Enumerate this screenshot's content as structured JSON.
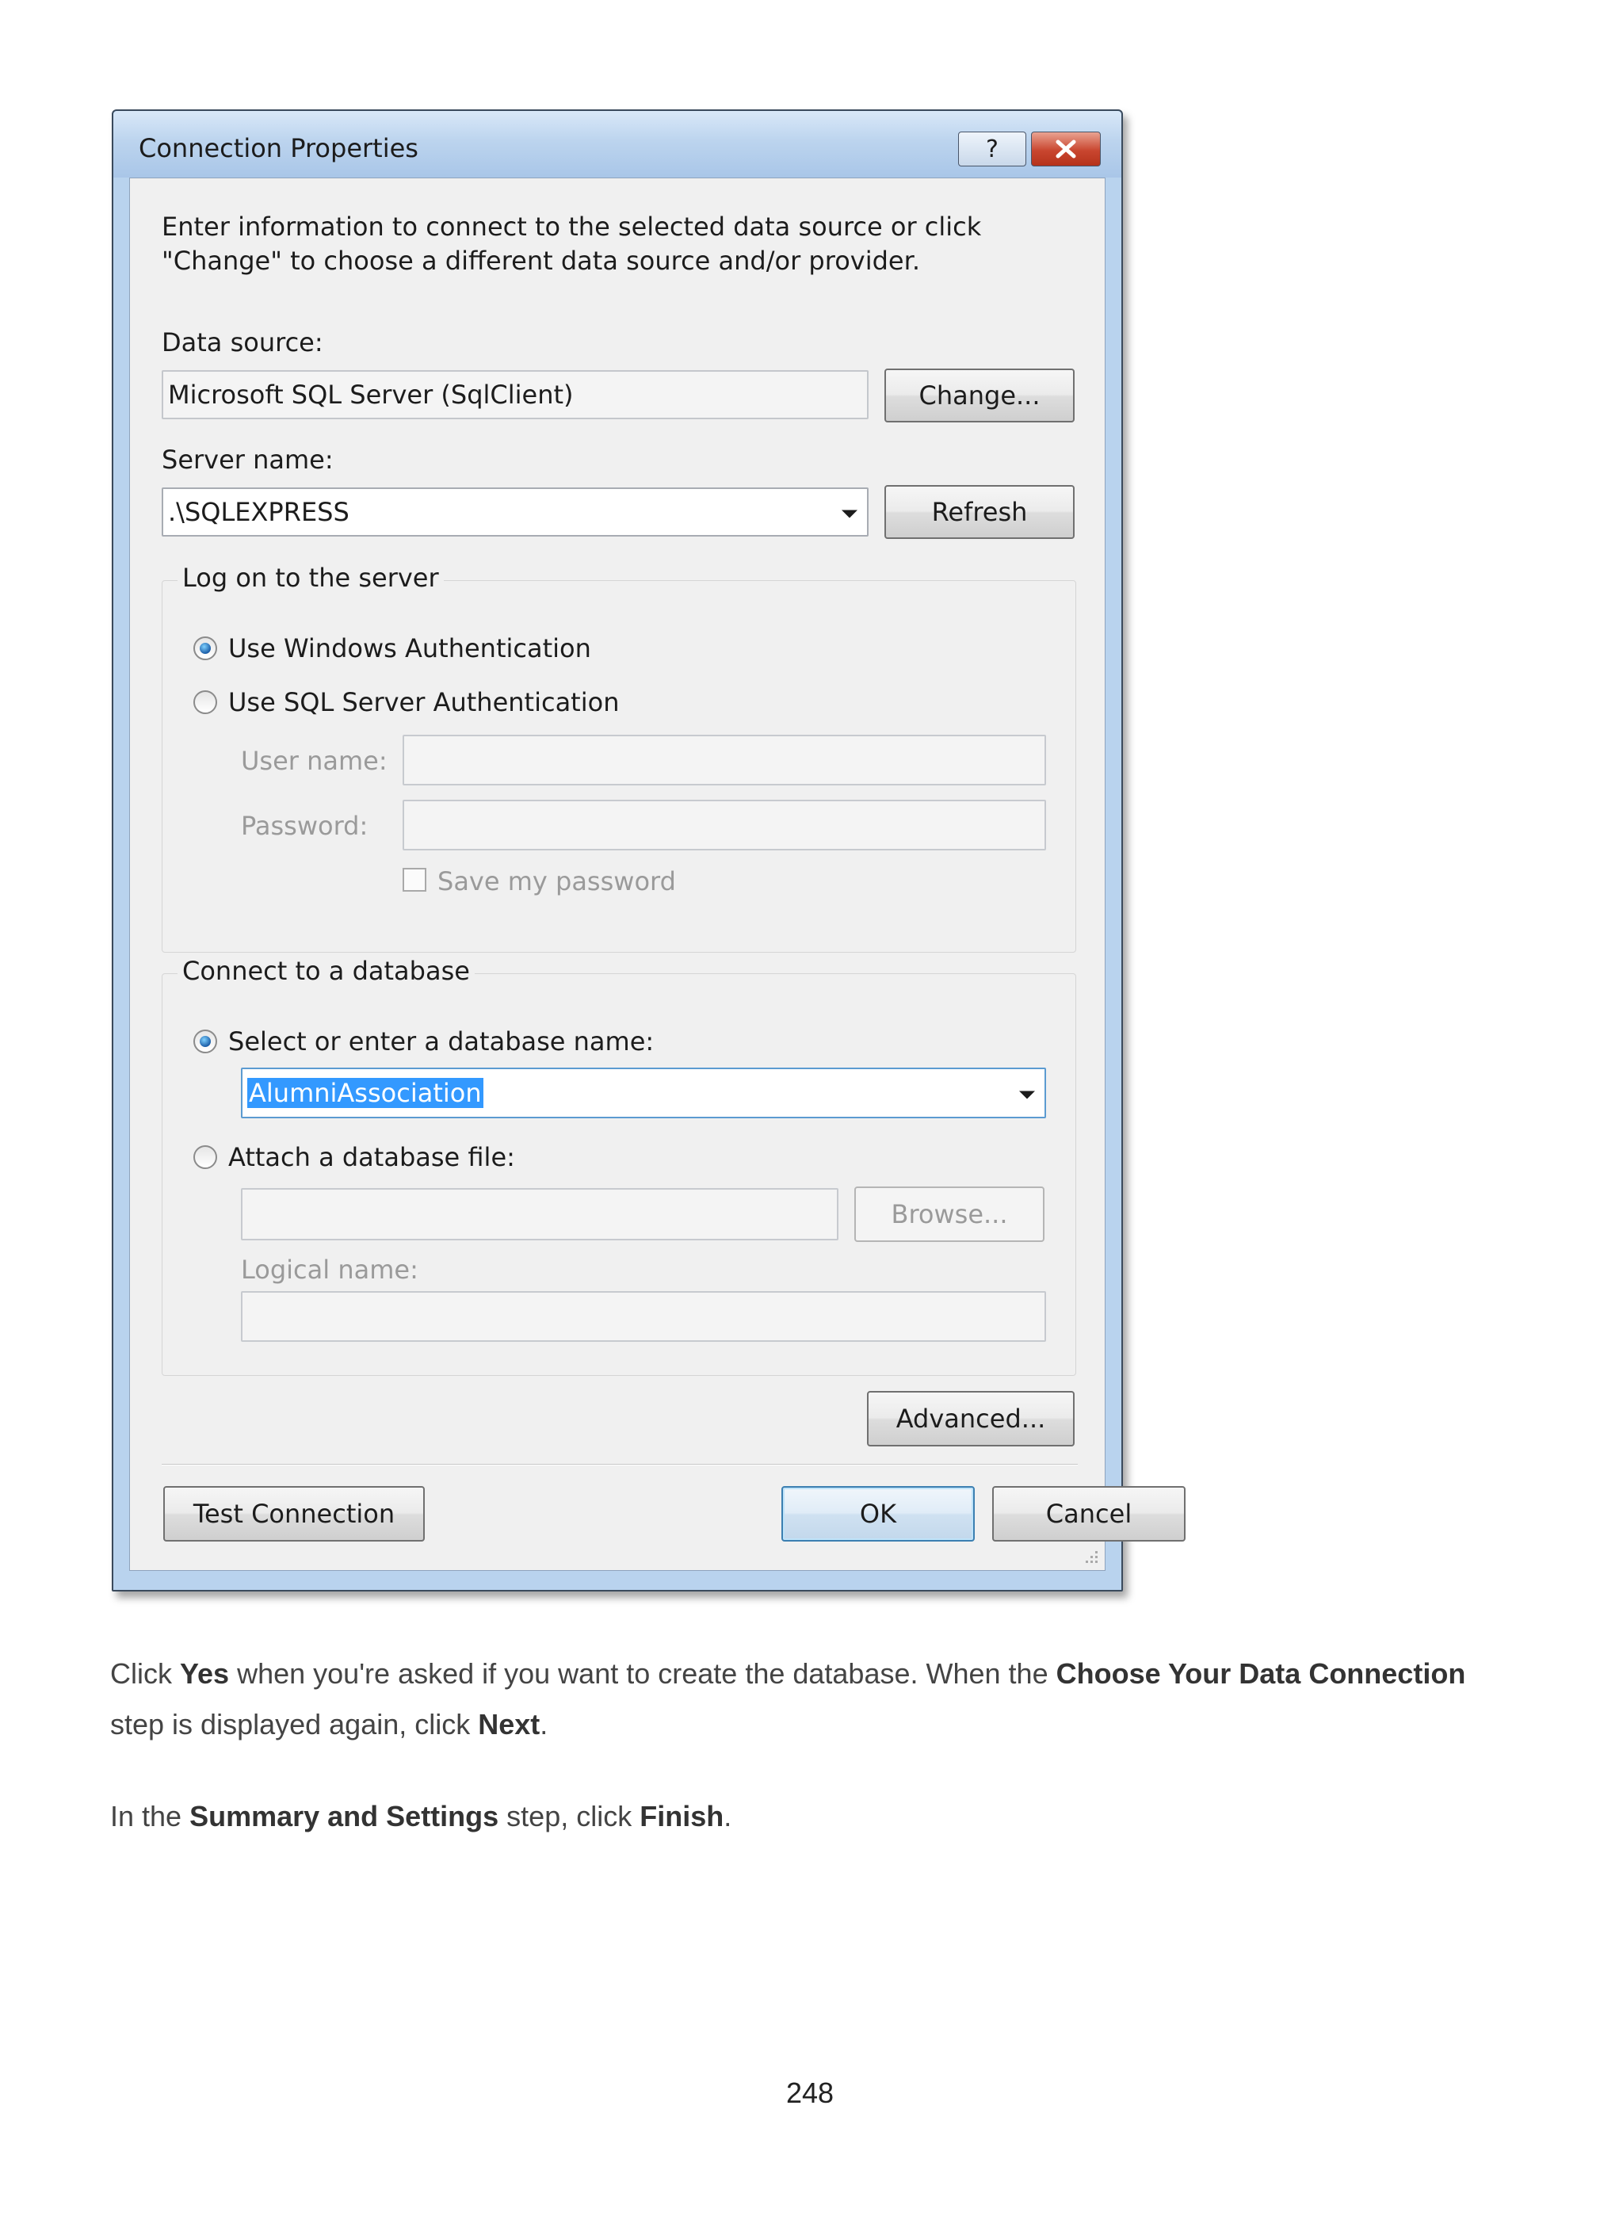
{
  "window": {
    "title": "Connection Properties",
    "help_label": "?",
    "intro": "Enter information to connect to the selected data source or click \"Change\" to choose a different data source and/or provider."
  },
  "data_source": {
    "label": "Data source:",
    "value": "Microsoft SQL Server (SqlClient)",
    "change_label": "Change..."
  },
  "server": {
    "label": "Server name:",
    "value": ".\\SQLEXPRESS",
    "refresh_label": "Refresh"
  },
  "logon": {
    "legend": "Log on to the server",
    "windows_auth": "Use Windows Authentication",
    "sql_auth": "Use SQL Server Authentication",
    "selected": "windows",
    "username_label": "User name:",
    "password_label": "Password:",
    "save_password": "Save my password"
  },
  "database": {
    "legend": "Connect to a database",
    "select_label": "Select or enter a database name:",
    "db_name": "AlumniAssociation",
    "attach_label": "Attach a database file:",
    "browse_label": "Browse...",
    "logical_label": "Logical name:",
    "selected": "select"
  },
  "buttons": {
    "advanced": "Advanced...",
    "test": "Test Connection",
    "ok": "OK",
    "cancel": "Cancel"
  },
  "text": {
    "p1_a": "Click ",
    "p1_b": "Yes",
    "p1_c": " when you're asked if you want to create the database. When the ",
    "p1_d": "Choose Your Data Connection",
    "p1_e": " step is displayed again, click ",
    "p1_f": "Next",
    "p1_g": ".",
    "p2_a": "In the ",
    "p2_b": "Summary and Settings",
    "p2_c": " step, click ",
    "p2_d": "Finish",
    "p2_e": "."
  },
  "page_number": "248",
  "colors": {
    "selection": "#3399ff",
    "close_button": "#c9462f",
    "title_bar": "#bcd4ee"
  }
}
